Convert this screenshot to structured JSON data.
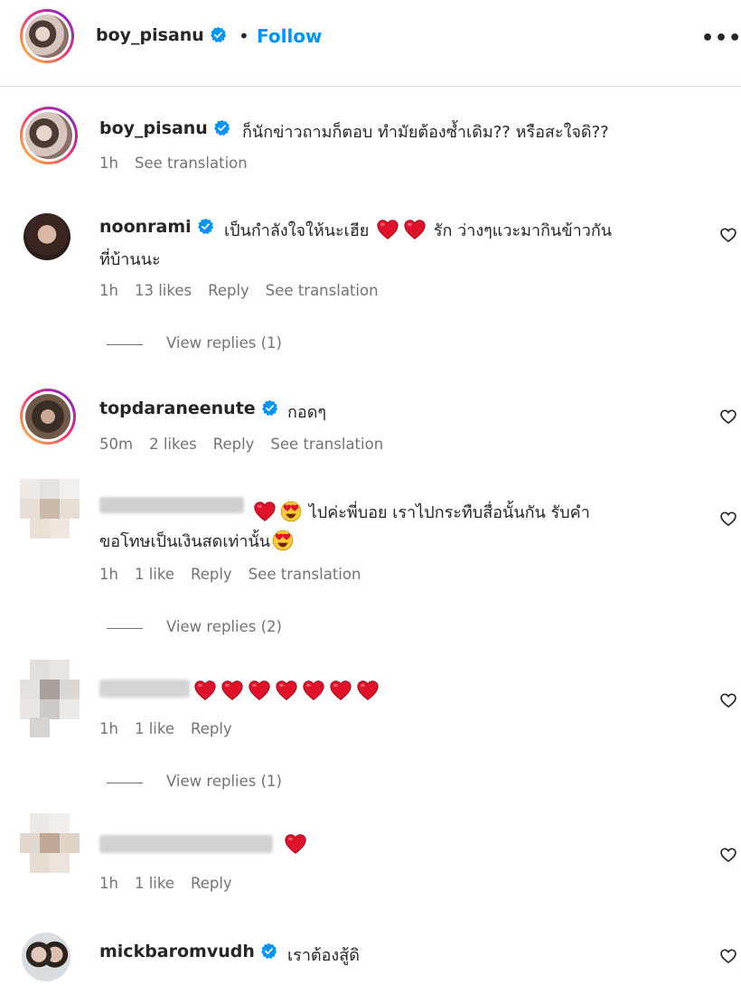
{
  "post_header": {
    "username": "boy_pisanu",
    "separator": "•",
    "follow_label": "Follow",
    "more_label": "•••"
  },
  "caption": {
    "username": "boy_pisanu",
    "text": "ก็นักข่าวถามก็ตอบ ทำมัยต้องซ้ำเดิม?? หรือสะใจดิ??",
    "time": "1h",
    "see_translation": "See translation"
  },
  "comments": [
    {
      "username": "noonrami",
      "text_line1": "เป็นกำลังใจให้นะเฮีย",
      "text_line1b": "รัก ว่างๆแวะมากินข้าวกัน",
      "text_line2": "ที่บ้านนะ",
      "time": "1h",
      "likes": "13 likes",
      "reply": "Reply",
      "see_translation": "See translation",
      "view_replies": "View replies (1)"
    },
    {
      "username": "topdaraneenute",
      "text": "กอดๆ",
      "time": "50m",
      "likes": "2 likes",
      "reply": "Reply",
      "see_translation": "See translation"
    },
    {
      "text_line1": "ไปค่ะพี่บอย เราไปกระทืบสื่อนั้นกัน รับคำ",
      "text_line2": "ขอโทษเป็นเงินสดเท่านั้น",
      "time": "1h",
      "likes": "1 like",
      "reply": "Reply",
      "see_translation": "See translation",
      "view_replies": "View replies (2)"
    },
    {
      "time": "1h",
      "likes": "1 like",
      "reply": "Reply",
      "view_replies": "View replies (1)"
    },
    {
      "time": "1h",
      "likes": "1 like",
      "reply": "Reply"
    },
    {
      "username": "mickbaromvudh",
      "text": "เราต้องสู้ดิ"
    }
  ],
  "colors": {
    "link_blue": "#0095f6",
    "verified_blue": "#0095f6",
    "heart_red": "#e0112b",
    "meta_gray": "#737373"
  }
}
